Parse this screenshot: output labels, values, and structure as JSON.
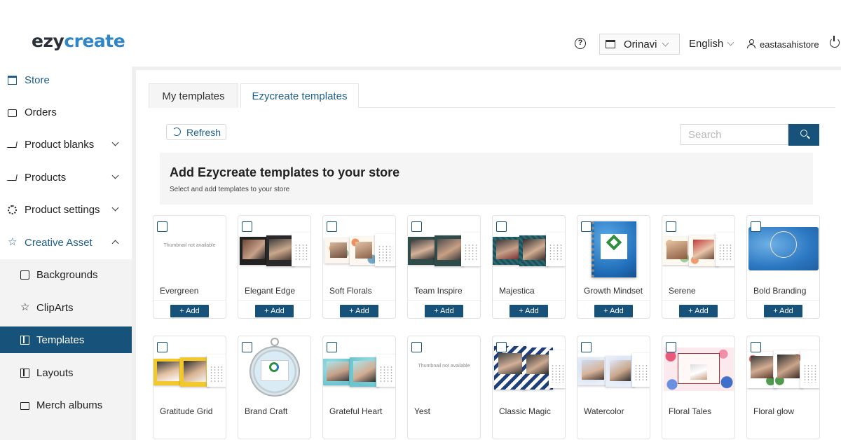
{
  "header": {
    "logo_part1": "ezy",
    "logo_part2": "create",
    "help_icon": "?",
    "store_name": "Orinavi",
    "language": "English",
    "username": "eastasahistore"
  },
  "sidebar": {
    "items": [
      {
        "label": "Store",
        "icon": "store-icon"
      },
      {
        "label": "Orders",
        "icon": "bag-icon"
      },
      {
        "label": "Product blanks",
        "icon": "cart-icon"
      },
      {
        "label": "Products",
        "icon": "cart-icon"
      },
      {
        "label": "Product settings",
        "icon": "gear-icon"
      },
      {
        "label": "Creative Asset",
        "icon": "star-icon"
      },
      {
        "label": "Backgrounds",
        "icon": "image-icon"
      },
      {
        "label": "ClipArts",
        "icon": "star-icon"
      },
      {
        "label": "Templates",
        "icon": "layout-icon"
      },
      {
        "label": "Layouts",
        "icon": "layout-icon"
      },
      {
        "label": "Merch albums",
        "icon": "folder-icon"
      }
    ],
    "star_glyph": "☆"
  },
  "tabs": {
    "my": "My templates",
    "ezy": "Ezycreate templates"
  },
  "toolbar": {
    "refresh_label": "Refresh",
    "search_placeholder": "Search"
  },
  "banner": {
    "title": "Add Ezycreate templates to your store",
    "subtitle": "Select and add templates to your store"
  },
  "thumbnail_not_available": "Thumbnail not available",
  "add_label": "+ Add",
  "templates_row1": [
    {
      "name": "Evergreen"
    },
    {
      "name": "Elegant Edge"
    },
    {
      "name": "Soft Florals"
    },
    {
      "name": "Team Inspire"
    },
    {
      "name": "Majestica"
    },
    {
      "name": "Growth Mindset"
    },
    {
      "name": "Serene"
    },
    {
      "name": "Bold Branding"
    }
  ],
  "templates_row2": [
    {
      "name": "Gratitude Grid"
    },
    {
      "name": "Brand Craft"
    },
    {
      "name": "Grateful Heart"
    },
    {
      "name": "Yest"
    },
    {
      "name": "Classic Magic"
    },
    {
      "name": "Watercolor"
    },
    {
      "name": "Floral Tales"
    },
    {
      "name": "Floral glow"
    }
  ],
  "colors": {
    "primary": "#17527a",
    "accent": "#2e86c8",
    "sidebar_active": "#17527a"
  }
}
